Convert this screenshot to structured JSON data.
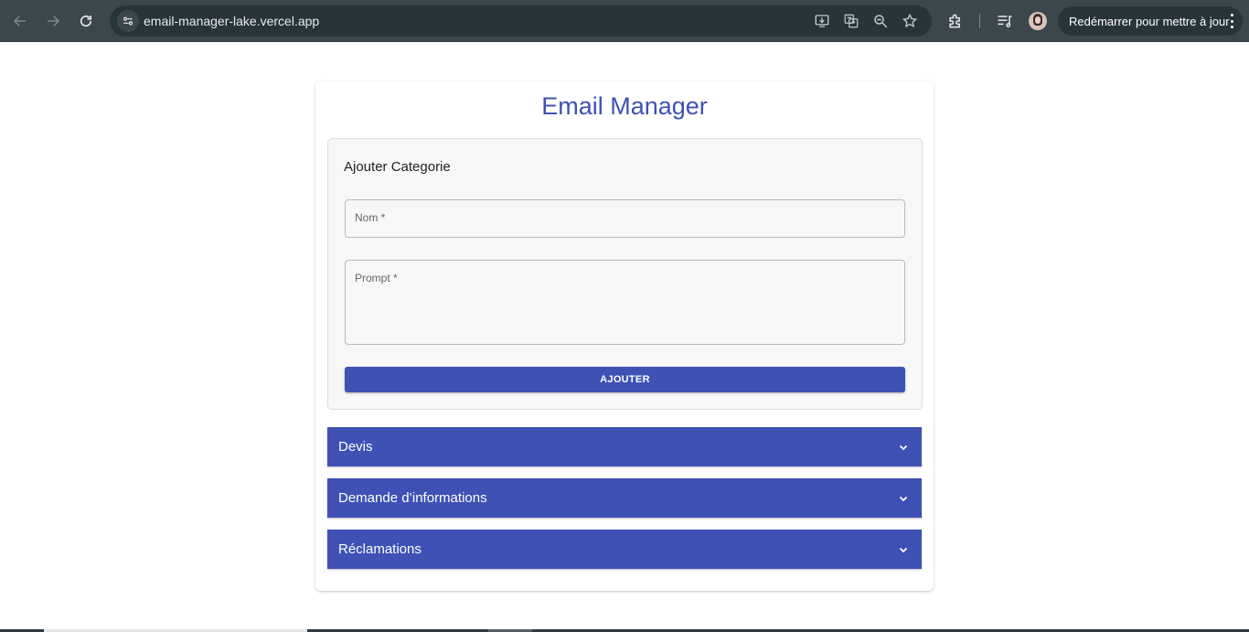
{
  "browser": {
    "url": "email-manager-lake.vercel.app",
    "update_button_label": "Redémarrer pour mettre à jour",
    "icons": [
      "back-icon",
      "forward-icon",
      "reload-icon",
      "site-info-icon",
      "install-app-icon",
      "translate-icon",
      "zoom-icon",
      "bookmark-star-icon",
      "extensions-icon",
      "media-control-icon",
      "profile-avatar",
      "menu-kebab-icon"
    ]
  },
  "app": {
    "title": "Email Manager"
  },
  "form": {
    "heading": "Ajouter Categorie",
    "name_label": "Nom *",
    "name_value": "",
    "prompt_label": "Prompt *",
    "prompt_value": "",
    "submit_label": "AJOUTER"
  },
  "categories": [
    {
      "label": "Devis"
    },
    {
      "label": "Demande d’informations"
    },
    {
      "label": "Réclamations"
    }
  ],
  "colors": {
    "primary": "#3f51b5",
    "chrome_bg": "#3c474d",
    "omnibox_bg": "#27343a",
    "panel_bg": "#f7f7f7"
  }
}
